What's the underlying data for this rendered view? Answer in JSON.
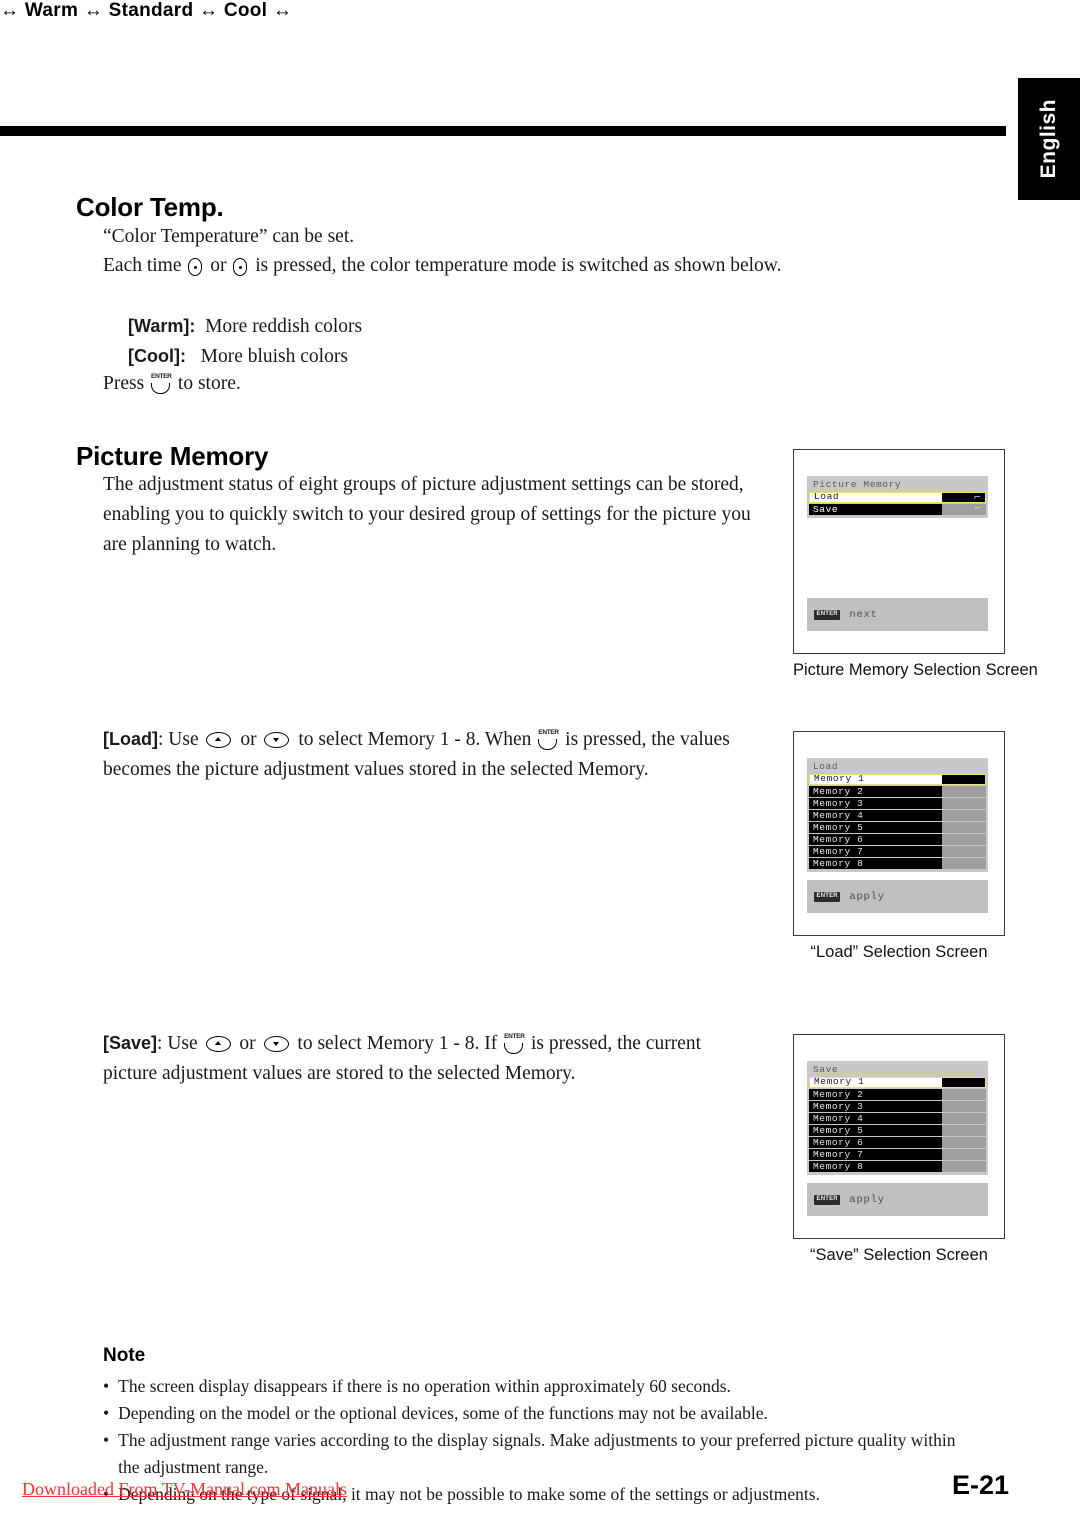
{
  "page": {
    "language_tab": "English",
    "page_number": "E-21",
    "watermark": "Downloaded From TV-Manual.com Manuals"
  },
  "color_temp": {
    "heading": "Color Temp.",
    "line1": "“Color Temperature” can be set.",
    "line2_before": "Each time",
    "line2_or": "or",
    "line2_after": "is pressed, the color temperature mode is switched as shown below.",
    "modes_line": "↔ Warm ↔ Standard ↔ Cool ↔",
    "warm_label": "[Warm]:",
    "warm_desc": "More reddish colors",
    "cool_label": "[Cool]:",
    "cool_desc": "More bluish colors",
    "press_before": "Press",
    "press_after": "to store.",
    "enter_key_label": "ENTER"
  },
  "picture_memory": {
    "heading": "Picture Memory",
    "intro": "The adjustment status of eight groups of picture adjustment settings can be stored, enabling you to quickly switch to your desired group of settings for the picture you are planning to watch.",
    "load_label": "[Load]",
    "load_text_1": ": Use",
    "load_text_or": "or",
    "load_text_2": "to select Memory 1 - 8. When",
    "load_text_3": "is pressed, the values becomes the picture adjustment values stored in the selected Memory.",
    "save_label": "[Save]",
    "save_text_1": ": Use",
    "save_text_or": "or",
    "save_text_2": "to select Memory 1 - 8. If",
    "save_text_3": "is pressed, the current picture adjustment values are stored to the selected Memory."
  },
  "osd_picture_memory": {
    "caption": "Picture Memory Selection Screen",
    "title": "Picture Memory",
    "rows": [
      {
        "label": "Load",
        "state": "selected",
        "arrow": "⌐"
      },
      {
        "label": "Save",
        "state": "dark",
        "arrow": "⌐"
      }
    ],
    "guide_key": "ENTER",
    "guide_label": "next"
  },
  "osd_load": {
    "caption": "“Load” Selection Screen",
    "title": "Load",
    "rows": [
      {
        "label": "Memory 1",
        "state": "selected"
      },
      {
        "label": "Memory 2",
        "state": "normal"
      },
      {
        "label": "Memory 3",
        "state": "normal"
      },
      {
        "label": "Memory 4",
        "state": "normal"
      },
      {
        "label": "Memory 5",
        "state": "normal"
      },
      {
        "label": "Memory 6",
        "state": "normal"
      },
      {
        "label": "Memory 7",
        "state": "normal"
      },
      {
        "label": "Memory 8",
        "state": "normal"
      }
    ],
    "guide_key": "ENTER",
    "guide_label": "apply"
  },
  "osd_save": {
    "caption": "“Save” Selection Screen",
    "title": "Save",
    "rows": [
      {
        "label": "Memory 1",
        "state": "selected"
      },
      {
        "label": "Memory 2",
        "state": "normal"
      },
      {
        "label": "Memory 3",
        "state": "normal"
      },
      {
        "label": "Memory 4",
        "state": "normal"
      },
      {
        "label": "Memory 5",
        "state": "normal"
      },
      {
        "label": "Memory 6",
        "state": "normal"
      },
      {
        "label": "Memory 7",
        "state": "normal"
      },
      {
        "label": "Memory 8",
        "state": "normal"
      }
    ],
    "guide_key": "ENTER",
    "guide_label": "apply"
  },
  "note": {
    "title": "Note",
    "bullet": "•",
    "items": [
      "The screen display disappears if there is no operation within approximately 60 seconds.",
      "Depending on the model or the optional devices, some of the functions may not be available.",
      "The adjustment range varies according to the display signals. Make adjustments to your preferred picture quality within the adjustment range.",
      "Depending on the type of signal, it may not be possible to make some of the settings or adjustments."
    ]
  },
  "colors": {
    "highlight_border": "#e8e36a",
    "osd_panel_bg": "#c8c8c8",
    "osd_row_dark": "#000000",
    "osd_value_grey": "#9e9e9e",
    "watermark_red": "#ff2f2f"
  }
}
